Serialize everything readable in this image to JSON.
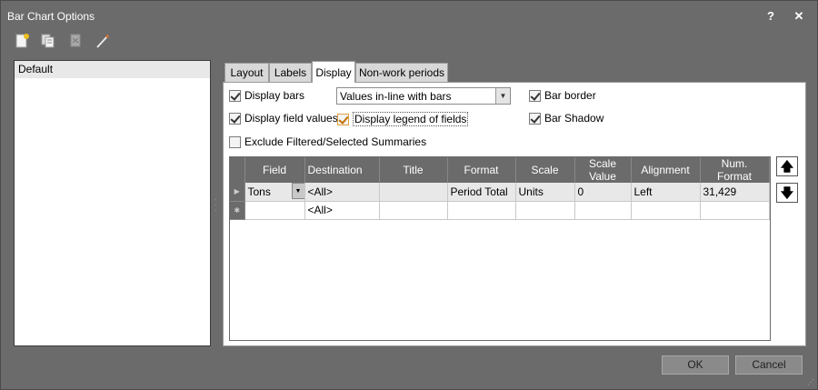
{
  "window": {
    "title": "Bar Chart Options",
    "help_label": "?",
    "close_label": "✕"
  },
  "toolbar": {
    "icons": [
      "new-icon",
      "copy-icon",
      "delete-icon",
      "edit-icon"
    ]
  },
  "sidebar": {
    "items": [
      {
        "label": "Default",
        "selected": true
      }
    ]
  },
  "tabs": [
    {
      "label": "Layout",
      "active": false
    },
    {
      "label": "Labels",
      "active": false
    },
    {
      "label": "Display",
      "active": true
    },
    {
      "label": "Non-work periods",
      "active": false
    }
  ],
  "display": {
    "display_bars": {
      "label": "Display bars",
      "checked": true
    },
    "bars_mode": {
      "value": "Values in-line with bars"
    },
    "bar_border": {
      "label": "Bar border",
      "checked": true
    },
    "display_field_values": {
      "label": "Display field values",
      "checked": true
    },
    "display_legend": {
      "label": "Display legend of fields",
      "checked": true
    },
    "bar_shadow": {
      "label": "Bar Shadow",
      "checked": true
    },
    "exclude_filtered": {
      "label": "Exclude Filtered/Selected Summaries",
      "checked": false
    }
  },
  "grid": {
    "columns": [
      "Field",
      "Destination",
      "Title",
      "Format",
      "Scale",
      "Scale Value",
      "Alignment",
      "Num. Format"
    ],
    "rows": [
      {
        "field": "Tons",
        "destination": "<All>",
        "title": "",
        "format": "Period Total",
        "scale": "Units",
        "scale_value": "0",
        "alignment": "Left",
        "num_format": "31,429"
      },
      {
        "field": "",
        "destination": "<All>",
        "title": "",
        "format": "",
        "scale": "",
        "scale_value": "",
        "alignment": "",
        "num_format": ""
      }
    ]
  },
  "buttons": {
    "ok": "OK",
    "cancel": "Cancel"
  }
}
